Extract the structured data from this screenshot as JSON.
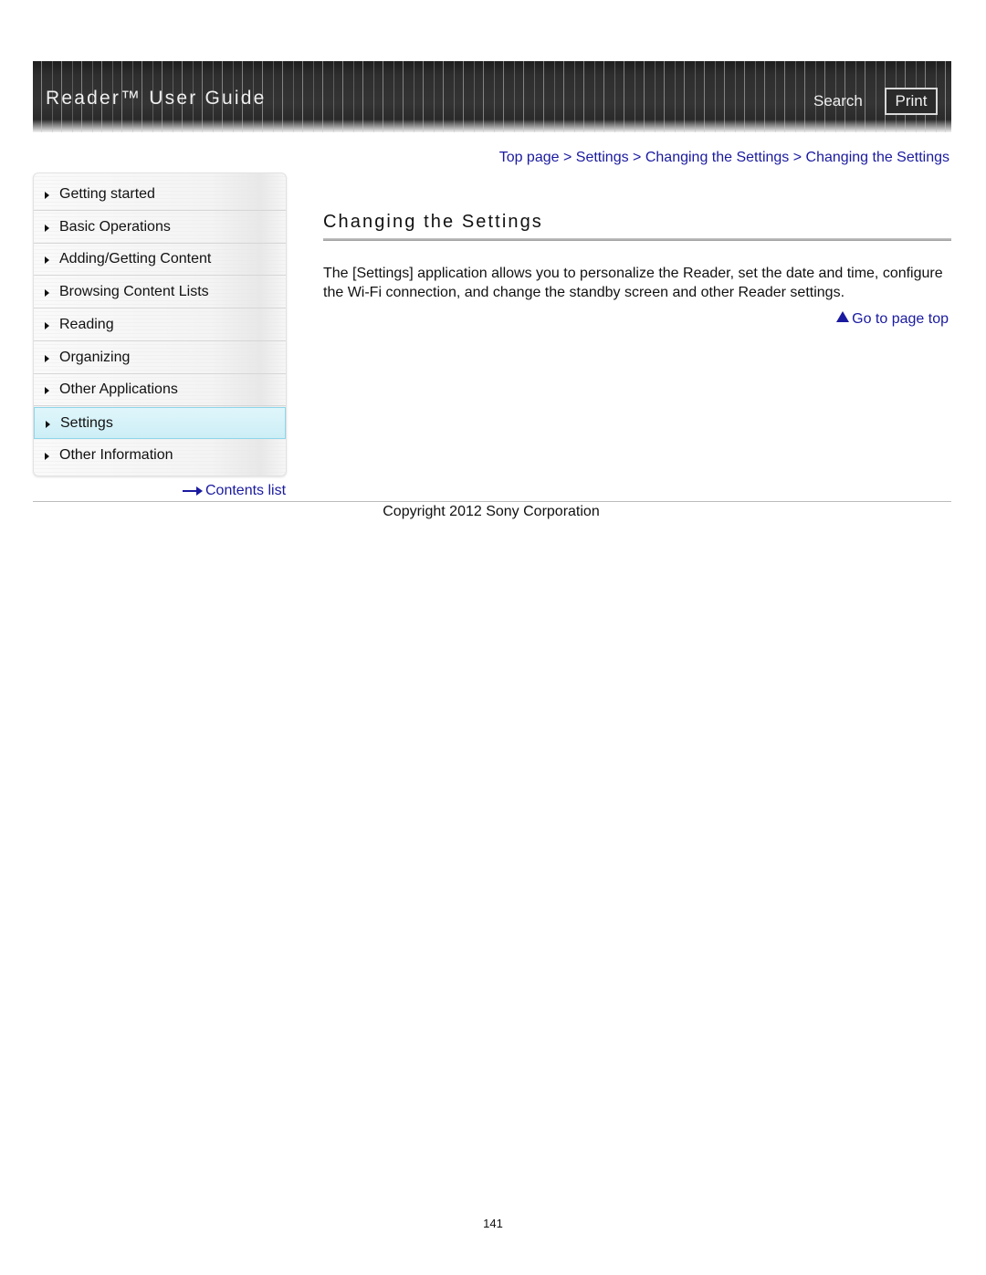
{
  "header": {
    "title": "Reader™ User Guide",
    "search_label": "Search",
    "print_label": "Print"
  },
  "breadcrumb": {
    "items": [
      "Top page",
      "Settings",
      "Changing the Settings",
      "Changing the Settings"
    ],
    "separator": ">"
  },
  "sidebar": {
    "items": [
      {
        "label": "Getting started",
        "active": false
      },
      {
        "label": "Basic Operations",
        "active": false
      },
      {
        "label": "Adding/Getting Content",
        "active": false
      },
      {
        "label": "Browsing Content Lists",
        "active": false
      },
      {
        "label": "Reading",
        "active": false
      },
      {
        "label": "Organizing",
        "active": false
      },
      {
        "label": "Other Applications",
        "active": false
      },
      {
        "label": "Settings",
        "active": true
      },
      {
        "label": "Other Information",
        "active": false
      }
    ],
    "contents_link": "Contents list"
  },
  "main": {
    "title": "Changing the Settings",
    "body": "The [Settings] application allows you to personalize the Reader, set the date and time, configure the Wi-Fi connection, and change the standby screen and other Reader settings.",
    "page_top_link": "Go to page top"
  },
  "footer": {
    "copyright": "Copyright 2012 Sony Corporation",
    "page_number": "141"
  },
  "colors": {
    "link": "#1a1aa0",
    "active_nav_bg": "#d6f2f8",
    "active_nav_border": "#8fd6ea",
    "header_bg": "#2e2e2e"
  }
}
